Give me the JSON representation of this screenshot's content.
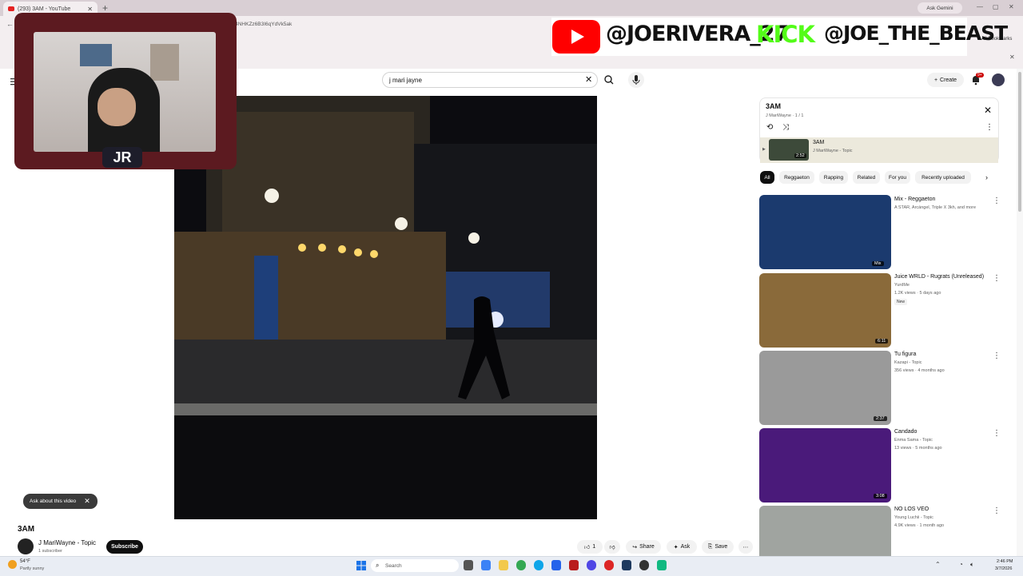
{
  "browser": {
    "tab_title": "(293) 3AM - YouTube",
    "url": "…g4NHKZz6B3I6qYdVk5ak",
    "ask_gemini": "Ask Gemini",
    "all_bookmarks": "All Bookmarks"
  },
  "overlay": {
    "youtube_handle": "@JOERIVERA_27",
    "kick_label": "KICK",
    "kick_handle": "@JOE_THE_BEAST",
    "cam_logo": "JR"
  },
  "header": {
    "search_value": "j mari jayne",
    "create_label": "Create",
    "notification_count": "9+"
  },
  "video": {
    "ask_chip": "Ask about this video",
    "title": "3AM",
    "channel": "J MariWayne - Topic",
    "subscribers": "1 subscriber",
    "subscribe_label": "Subscribe",
    "like_count": "1",
    "share_label": "Share",
    "ask_label": "Ask",
    "save_label": "Save"
  },
  "playlist": {
    "title": "3AM",
    "subtitle": "J MariWayne · 1 / 1",
    "item": {
      "title": "3AM",
      "channel": "J MariWayne - Topic",
      "duration": "2:52"
    }
  },
  "chips": [
    "All",
    "Reggaeton",
    "Rapping",
    "Related",
    "For you",
    "Recently uploaded"
  ],
  "recommendations": [
    {
      "title": "Mix - Reggaeton",
      "meta1": "A STAR, Arcángel, Triple X 3kh, and more",
      "meta2": "",
      "duration": "Mix",
      "thumb_color": "#1b3a6e"
    },
    {
      "title": "Juice WRLD - Rugrats (Unreleased)",
      "meta1": "YurdMe",
      "meta2": "1.2K views · 5 days ago",
      "duration": "6:11",
      "thumb_color": "#8a6a3a"
    },
    {
      "title": "Tu figura",
      "meta1": "Kazapi - Topic",
      "meta2": "356 views · 4 months ago",
      "duration": "2:37",
      "thumb_color": "#9a9a9a"
    },
    {
      "title": "Candado",
      "meta1": "Enma Sama - Topic",
      "meta2": "13 views · 5 months ago",
      "duration": "3:08",
      "thumb_color": "#4a1a7a"
    },
    {
      "title": "NO LOS VEO",
      "meta1": "Young Luchii - Topic",
      "meta2": "4.9K views · 1 month ago",
      "duration": "",
      "thumb_color": "#a0a4a0"
    }
  ],
  "new_badge": "New",
  "taskbar": {
    "temperature": "54°F",
    "condition": "Partly sunny",
    "search_placeholder": "Search",
    "time": "2:46 PM",
    "date": "3/7/2026"
  }
}
